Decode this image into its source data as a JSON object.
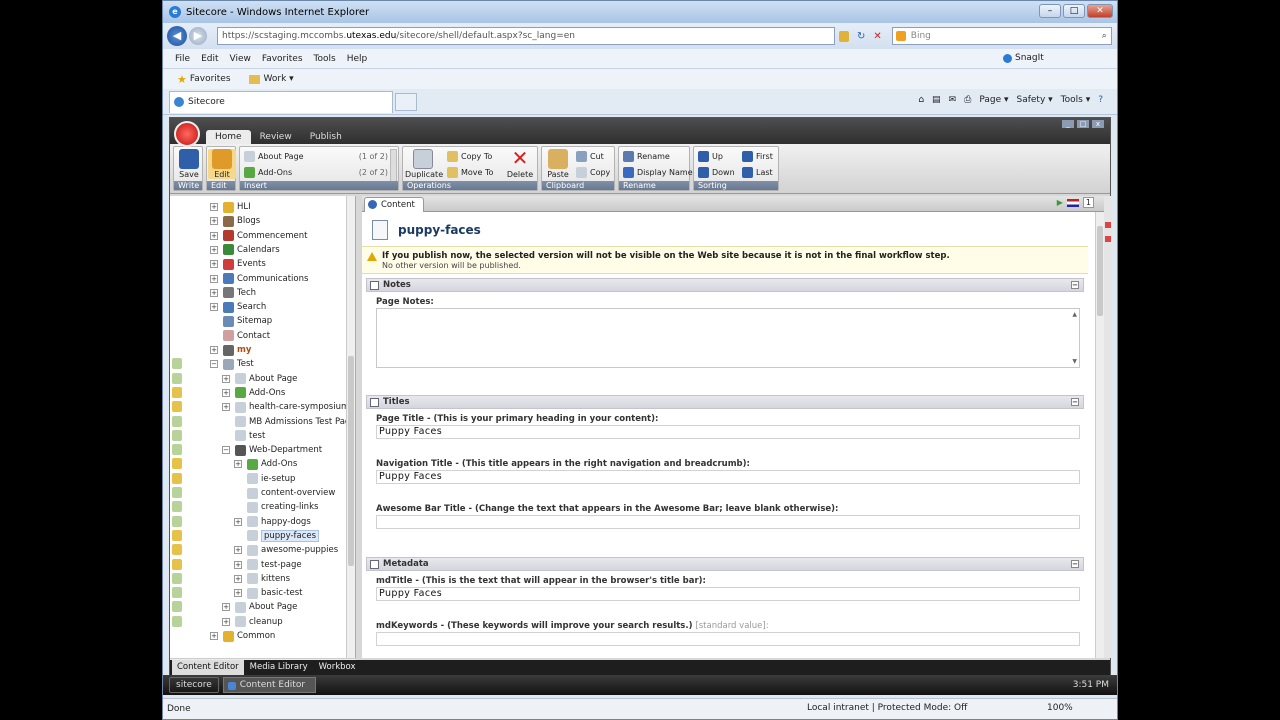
{
  "window": {
    "title": "Sitecore - Windows Internet Explorer",
    "min": "–",
    "max": "□",
    "close": "✕"
  },
  "address": {
    "url_prefix": "https://scstaging.mccombs.",
    "url_domain": "utexas.edu",
    "url_path": "/sitecore/shell/default.aspx?sc_lang=en",
    "search_placeholder": "Bing"
  },
  "menu": [
    "File",
    "Edit",
    "View",
    "Favorites",
    "Tools",
    "Help"
  ],
  "snagit": "SnagIt",
  "favorites": {
    "label": "Favorites",
    "work": "Work ▾"
  },
  "tab": {
    "label": "Sitecore"
  },
  "commandbar": [
    "Page ▾",
    "Safety ▾",
    "Tools ▾"
  ],
  "ribbon": {
    "tabs": [
      "Home",
      "Review",
      "Publish"
    ],
    "save": "Save",
    "edit": "Edit",
    "write_group": "Write",
    "edit_group": "Edit",
    "insert_items": [
      {
        "label": "About Page",
        "count": "(1 of 2)"
      },
      {
        "label": "Add-Ons",
        "count": "(2 of 2)"
      }
    ],
    "insert_group": "Insert",
    "duplicate": "Duplicate",
    "copy_to": "Copy To",
    "move_to": "Move To",
    "delete": "Delete",
    "operations_group": "Operations",
    "paste": "Paste",
    "cut": "Cut",
    "copy": "Copy",
    "clipboard_group": "Clipboard",
    "rename": "Rename",
    "display_name": "Display Name",
    "rename_group": "Rename",
    "up": "Up",
    "down": "Down",
    "first": "First",
    "last": "Last",
    "sorting_group": "Sorting"
  },
  "tree": [
    {
      "label": "HLI",
      "indent": 0,
      "exp": "+",
      "icon": "#e3b12f",
      "lock": ""
    },
    {
      "label": "Blogs",
      "indent": 0,
      "exp": "+",
      "icon": "#8b6a4a",
      "lock": ""
    },
    {
      "label": "Commencement",
      "indent": 0,
      "exp": "+",
      "icon": "#b43a2e",
      "lock": ""
    },
    {
      "label": "Calendars",
      "indent": 0,
      "exp": "+",
      "icon": "#3a8a3a",
      "lock": ""
    },
    {
      "label": "Events",
      "indent": 0,
      "exp": "+",
      "icon": "#d23b3b",
      "lock": ""
    },
    {
      "label": "Communications",
      "indent": 0,
      "exp": "+",
      "icon": "#4a7ab8",
      "lock": ""
    },
    {
      "label": "Tech",
      "indent": 0,
      "exp": "+",
      "icon": "#777777",
      "lock": ""
    },
    {
      "label": "Search",
      "indent": 0,
      "exp": "+",
      "icon": "#4a7ab8",
      "lock": ""
    },
    {
      "label": "Sitemap",
      "indent": 0,
      "exp": "",
      "icon": "#6a8ab8",
      "lock": ""
    },
    {
      "label": "Contact",
      "indent": 0,
      "exp": "",
      "icon": "#d0a0a0",
      "lock": ""
    },
    {
      "label": "my",
      "indent": 0,
      "exp": "+",
      "icon": "#666666",
      "lock": "",
      "bold": true
    },
    {
      "label": "Test",
      "indent": 0,
      "exp": "−",
      "icon": "#9aa8b8",
      "lock": "edit"
    },
    {
      "label": "About Page",
      "indent": 1,
      "exp": "+",
      "icon": "#c7cfd9",
      "lock": "edit"
    },
    {
      "label": "Add-Ons",
      "indent": 1,
      "exp": "+",
      "icon": "#58a844",
      "lock": "lock"
    },
    {
      "label": "health-care-symposium",
      "indent": 1,
      "exp": "+",
      "icon": "#c7cfd9",
      "lock": "lock"
    },
    {
      "label": "MB Admissions Test Page",
      "indent": 1,
      "exp": "",
      "icon": "#c7cfd9",
      "lock": "edit"
    },
    {
      "label": "test",
      "indent": 1,
      "exp": "",
      "icon": "#c7cfd9",
      "lock": "edit"
    },
    {
      "label": "Web-Department",
      "indent": 1,
      "exp": "−",
      "icon": "#555555",
      "lock": "edit"
    },
    {
      "label": "Add-Ons",
      "indent": 2,
      "exp": "+",
      "icon": "#58a844",
      "lock": "lock"
    },
    {
      "label": "ie-setup",
      "indent": 2,
      "exp": "",
      "icon": "#c7cfd9",
      "lock": "lock"
    },
    {
      "label": "content-overview",
      "indent": 2,
      "exp": "",
      "icon": "#c7cfd9",
      "lock": "edit"
    },
    {
      "label": "creating-links",
      "indent": 2,
      "exp": "",
      "icon": "#c7cfd9",
      "lock": "edit"
    },
    {
      "label": "happy-dogs",
      "indent": 2,
      "exp": "+",
      "icon": "#c7cfd9",
      "lock": "edit"
    },
    {
      "label": "puppy-faces",
      "indent": 2,
      "exp": "",
      "icon": "#c7cfd9",
      "lock": "lock",
      "selected": true
    },
    {
      "label": "awesome-puppies",
      "indent": 2,
      "exp": "+",
      "icon": "#c7cfd9",
      "lock": "lock"
    },
    {
      "label": "test-page",
      "indent": 2,
      "exp": "+",
      "icon": "#c7cfd9",
      "lock": "lock"
    },
    {
      "label": "kittens",
      "indent": 2,
      "exp": "+",
      "icon": "#c7cfd9",
      "lock": "edit"
    },
    {
      "label": "basic-test",
      "indent": 2,
      "exp": "+",
      "icon": "#c7cfd9",
      "lock": "edit"
    },
    {
      "label": "About Page",
      "indent": 1,
      "exp": "+",
      "icon": "#c7cfd9",
      "lock": "edit"
    },
    {
      "label": "cleanup",
      "indent": 1,
      "exp": "+",
      "icon": "#c7cfd9",
      "lock": "edit"
    },
    {
      "label": "Common",
      "indent": 0,
      "exp": "+",
      "icon": "#e3b12f",
      "lock": ""
    }
  ],
  "editor": {
    "tab": "Content",
    "version": "1",
    "page_title": "puppy-faces",
    "warning_main": "If you publish now, the selected version will not be visible on the Web site because it is not in the final workflow step.",
    "warning_sub": "No other version will be published.",
    "sections": {
      "notes": "Notes",
      "titles": "Titles",
      "metadata": "Metadata"
    },
    "fields": {
      "page_notes_label": "Page Notes:",
      "page_title_label": "Page Title - (This is your primary heading in your content):",
      "page_title_value": "Puppy Faces",
      "nav_title_label": "Navigation Title - (This title appears in the right navigation and breadcrumb):",
      "nav_title_value": "Puppy Faces",
      "awesome_label": "Awesome Bar Title - (Change the text that appears in the Awesome Bar; leave blank otherwise):",
      "awesome_value": "",
      "mdtitle_label": "mdTitle - (This is the text that will appear in the browser's title bar):",
      "mdtitle_value": "Puppy Faces",
      "mdkeywords_label": "mdKeywords - (These keywords will improve your search results.)",
      "mdkeywords_std": "[standard value]:"
    }
  },
  "bottom_tabs": [
    "Content Editor",
    "Media Library",
    "Workbox"
  ],
  "taskbar": {
    "start": "sitecore",
    "item": "Content Editor",
    "clock": "3:51 PM"
  },
  "status": {
    "left": "Done",
    "zone": "Local intranet | Protected Mode: Off",
    "zoom": "100%"
  }
}
